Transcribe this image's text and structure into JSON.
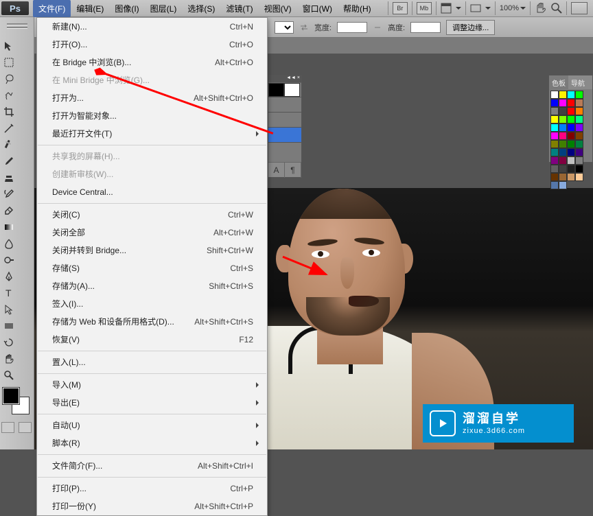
{
  "app": {
    "logo": "Ps"
  },
  "menubar": {
    "items": [
      "文件(F)",
      "编辑(E)",
      "图像(I)",
      "图层(L)",
      "选择(S)",
      "滤镜(T)",
      "视图(V)",
      "窗口(W)",
      "帮助(H)"
    ],
    "right_buttons": [
      "Br",
      "Mb"
    ],
    "zoom": "100%"
  },
  "options": {
    "width_label": "宽度:",
    "height_label": "高度:",
    "adjust_button": "调整边缘..."
  },
  "file_menu": {
    "items": [
      {
        "label": "新建(N)...",
        "shortcut": "Ctrl+N"
      },
      {
        "label": "打开(O)...",
        "shortcut": "Ctrl+O"
      },
      {
        "label": "在 Bridge 中浏览(B)...",
        "shortcut": "Alt+Ctrl+O"
      },
      {
        "label": "在 Mini Bridge 中浏览(G)...",
        "disabled": true
      },
      {
        "label": "打开为...",
        "shortcut": "Alt+Shift+Ctrl+O"
      },
      {
        "label": "打开为智能对象..."
      },
      {
        "label": "最近打开文件(T)",
        "submenu": true
      },
      {
        "sep": true
      },
      {
        "label": "共享我的屏幕(H)...",
        "disabled": true
      },
      {
        "label": "创建新审核(W)...",
        "disabled": true
      },
      {
        "label": "Device Central..."
      },
      {
        "sep": true
      },
      {
        "label": "关闭(C)",
        "shortcut": "Ctrl+W"
      },
      {
        "label": "关闭全部",
        "shortcut": "Alt+Ctrl+W"
      },
      {
        "label": "关闭并转到 Bridge...",
        "shortcut": "Shift+Ctrl+W"
      },
      {
        "label": "存储(S)",
        "shortcut": "Ctrl+S"
      },
      {
        "label": "存储为(A)...",
        "shortcut": "Shift+Ctrl+S"
      },
      {
        "label": "签入(I)..."
      },
      {
        "label": "存储为 Web 和设备所用格式(D)...",
        "shortcut": "Alt+Shift+Ctrl+S"
      },
      {
        "label": "恢复(V)",
        "shortcut": "F12"
      },
      {
        "sep": true
      },
      {
        "label": "置入(L)..."
      },
      {
        "sep": true
      },
      {
        "label": "导入(M)",
        "submenu": true
      },
      {
        "label": "导出(E)",
        "submenu": true
      },
      {
        "sep": true
      },
      {
        "label": "自动(U)",
        "submenu": true
      },
      {
        "label": "脚本(R)",
        "submenu": true
      },
      {
        "sep": true
      },
      {
        "label": "文件简介(F)...",
        "shortcut": "Alt+Shift+Ctrl+I"
      },
      {
        "sep": true
      },
      {
        "label": "打印(P)...",
        "shortcut": "Ctrl+P"
      },
      {
        "label": "打印一份(Y)",
        "shortcut": "Alt+Shift+Ctrl+P"
      }
    ]
  },
  "swatches": {
    "tab1": "色板",
    "tab2": "导航",
    "colors": [
      "#ffffff",
      "#fff100",
      "#00ffff",
      "#00ff00",
      "#0000ff",
      "#ff00ff",
      "#ff0000",
      "#b97a57",
      "#808080",
      "#404040",
      "#ff0000",
      "#ff8000",
      "#ffff00",
      "#80ff00",
      "#00ff00",
      "#00ff80",
      "#00ffff",
      "#0080ff",
      "#0000ff",
      "#8000ff",
      "#ff00ff",
      "#ff0080",
      "#800000",
      "#804000",
      "#808000",
      "#408000",
      "#008000",
      "#008040",
      "#008080",
      "#004080",
      "#000080",
      "#400080",
      "#800080",
      "#800040",
      "#c0c0c0",
      "#808080",
      "#606060",
      "#404040",
      "#202020",
      "#000000",
      "#663300",
      "#996633",
      "#cc9966",
      "#ffcc99",
      "#5577aa",
      "#88aadd"
    ]
  },
  "watermark": {
    "title": "溜溜自学",
    "url": "zixue.3d66.com"
  }
}
